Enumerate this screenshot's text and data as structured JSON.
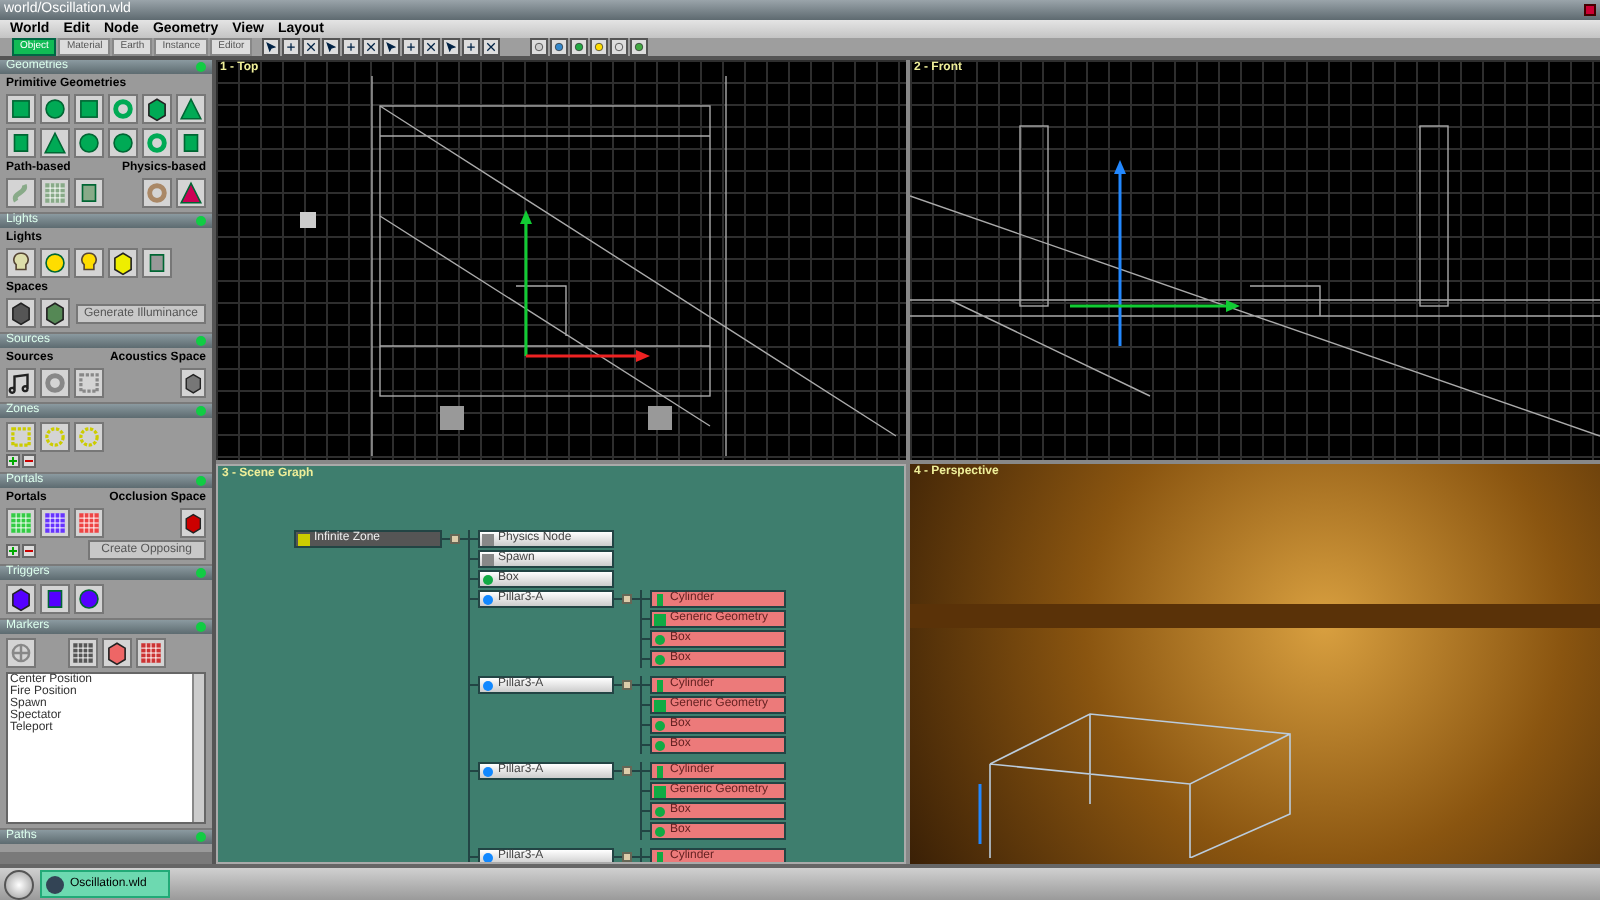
{
  "window": {
    "title": "world/Oscillation.wld"
  },
  "menu": [
    "World",
    "Edit",
    "Node",
    "Geometry",
    "View",
    "Layout"
  ],
  "mode_tabs": [
    {
      "label": "Object",
      "selected": true
    },
    {
      "label": "Material",
      "selected": false
    },
    {
      "label": "Earth",
      "selected": false
    },
    {
      "label": "Instance",
      "selected": false
    },
    {
      "label": "Editor",
      "selected": false
    }
  ],
  "sidebar": {
    "sections": [
      {
        "title": "Geometries",
        "expanded": true,
        "groups": [
          {
            "heading": "Primitive Geometries"
          },
          {
            "heading": "Path-based",
            "heading_right": "Physics-based"
          }
        ]
      },
      {
        "title": "Lights",
        "expanded": true,
        "groups": [
          {
            "heading": "Lights"
          },
          {
            "heading": "Spaces",
            "button": "Generate Illuminance"
          }
        ]
      },
      {
        "title": "Sources",
        "expanded": true,
        "groups": [
          {
            "heading": "Sources",
            "heading_right": "Acoustics Space"
          }
        ]
      },
      {
        "title": "Zones",
        "expanded": true
      },
      {
        "title": "Portals",
        "expanded": true,
        "groups": [
          {
            "heading": "Portals",
            "heading_right": "Occlusion Space",
            "button": "Create Opposing"
          }
        ]
      },
      {
        "title": "Triggers",
        "expanded": true
      },
      {
        "title": "Markers",
        "expanded": true,
        "list": [
          "Center Position",
          "Fire Position",
          "Spawn",
          "Spectator",
          "Teleport"
        ]
      },
      {
        "title": "Paths",
        "expanded": true
      }
    ]
  },
  "viewports": [
    {
      "title": "1 - Top"
    },
    {
      "title": "2 - Front"
    },
    {
      "title": "3 - Scene Graph"
    },
    {
      "title": "4 - Perspective"
    }
  ],
  "scene_graph": {
    "label": "Infinite Zone",
    "kind": "zone",
    "selected": false,
    "expanded": true,
    "children": [
      {
        "label": "Physics Node",
        "kind": "physics",
        "selected": false
      },
      {
        "label": "Spawn",
        "kind": "spawn",
        "selected": false
      },
      {
        "label": "Box",
        "kind": "box",
        "selected": false
      },
      {
        "label": "Pillar3-A",
        "kind": "instance",
        "selected": false,
        "expanded": true,
        "children": [
          {
            "label": "Cylinder",
            "kind": "cylinder",
            "selected": true
          },
          {
            "label": "Generic Geometry",
            "kind": "generic",
            "selected": true
          },
          {
            "label": "Box",
            "kind": "box",
            "selected": true
          },
          {
            "label": "Box",
            "kind": "box",
            "selected": true
          }
        ]
      },
      {
        "label": "Pillar3-A",
        "kind": "instance",
        "selected": false,
        "expanded": true,
        "children": [
          {
            "label": "Cylinder",
            "kind": "cylinder",
            "selected": true
          },
          {
            "label": "Generic Geometry",
            "kind": "generic",
            "selected": true
          },
          {
            "label": "Box",
            "kind": "box",
            "selected": true
          },
          {
            "label": "Box",
            "kind": "box",
            "selected": true
          }
        ]
      },
      {
        "label": "Pillar3-A",
        "kind": "instance",
        "selected": false,
        "expanded": true,
        "children": [
          {
            "label": "Cylinder",
            "kind": "cylinder",
            "selected": true
          },
          {
            "label": "Generic Geometry",
            "kind": "generic",
            "selected": true
          },
          {
            "label": "Box",
            "kind": "box",
            "selected": true
          },
          {
            "label": "Box",
            "kind": "box",
            "selected": true
          }
        ]
      },
      {
        "label": "Pillar3-A",
        "kind": "instance",
        "selected": false,
        "expanded": true,
        "children": [
          {
            "label": "Cylinder",
            "kind": "cylinder",
            "selected": true
          }
        ]
      }
    ]
  },
  "taskbar": {
    "items": [
      {
        "label": "Oscillation.wld",
        "selected": true
      }
    ]
  }
}
